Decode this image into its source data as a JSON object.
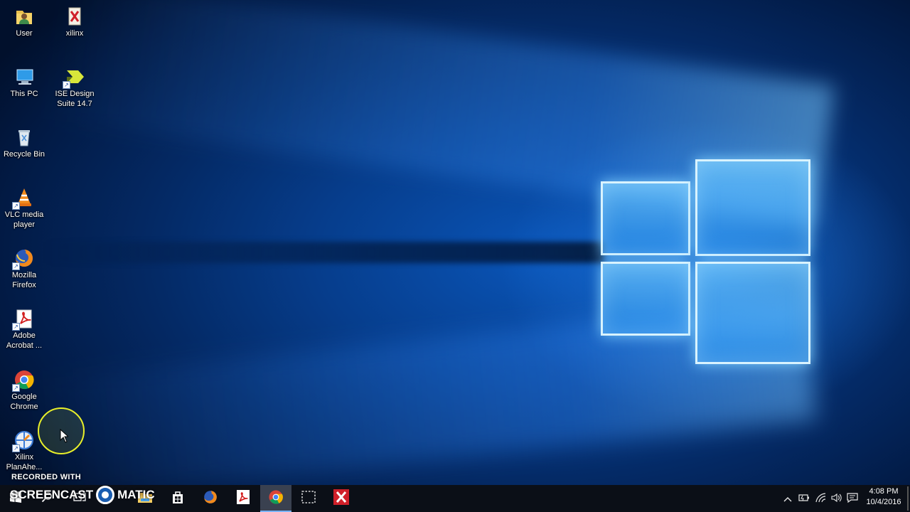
{
  "desktop": {
    "icons": [
      {
        "label": "User",
        "icon": "user-folder-icon"
      },
      {
        "label": "xilinx",
        "icon": "xilinx-folder-icon"
      },
      {
        "label": "This PC",
        "icon": "computer-icon"
      },
      {
        "label": "ISE Design Suite 14.7",
        "icon": "ise-design-suite-icon"
      },
      {
        "label": "Recycle Bin",
        "icon": "recycle-bin-icon"
      },
      {
        "label": "VLC media player",
        "icon": "vlc-icon"
      },
      {
        "label": "Mozilla Firefox",
        "icon": "firefox-icon"
      },
      {
        "label": "Adobe Acrobat ...",
        "icon": "acrobat-icon"
      },
      {
        "label": "Google Chrome",
        "icon": "chrome-icon"
      },
      {
        "label": "Xilinx PlanAhe...",
        "icon": "planahead-icon"
      }
    ]
  },
  "watermark": {
    "recorded_with": "RECORDED WITH",
    "brand_left": "SCREENCAST",
    "brand_right": "MATIC"
  },
  "taskbar": {
    "pinned": [
      {
        "name": "start",
        "icon": "windows-logo-icon",
        "active": false
      },
      {
        "name": "search",
        "icon": "search-icon",
        "active": false
      },
      {
        "name": "task-view",
        "icon": "task-view-icon",
        "active": false
      },
      {
        "name": "file-explorer",
        "icon": "folder-icon",
        "active": false
      },
      {
        "name": "store",
        "icon": "store-icon",
        "active": false
      },
      {
        "name": "firefox",
        "icon": "firefox-icon",
        "active": false
      },
      {
        "name": "acrobat",
        "icon": "acrobat-icon",
        "active": false
      },
      {
        "name": "chrome",
        "icon": "chrome-icon",
        "active": true
      },
      {
        "name": "snipping-tool",
        "icon": "snipping-icon",
        "active": false
      },
      {
        "name": "xilinx",
        "icon": "xilinx-icon",
        "active": false
      }
    ],
    "tray": [
      "chevron-up-icon",
      "battery-icon",
      "wifi-icon",
      "volume-icon",
      "action-center-icon"
    ],
    "time": "4:08 PM",
    "date": "10/4/2016"
  },
  "colors": {
    "wallpaper_blue": "#0a55b8",
    "taskbar": "#0b0f17",
    "cursor_highlight": "#e8ef2a",
    "active_indicator": "#7ab4ff"
  }
}
